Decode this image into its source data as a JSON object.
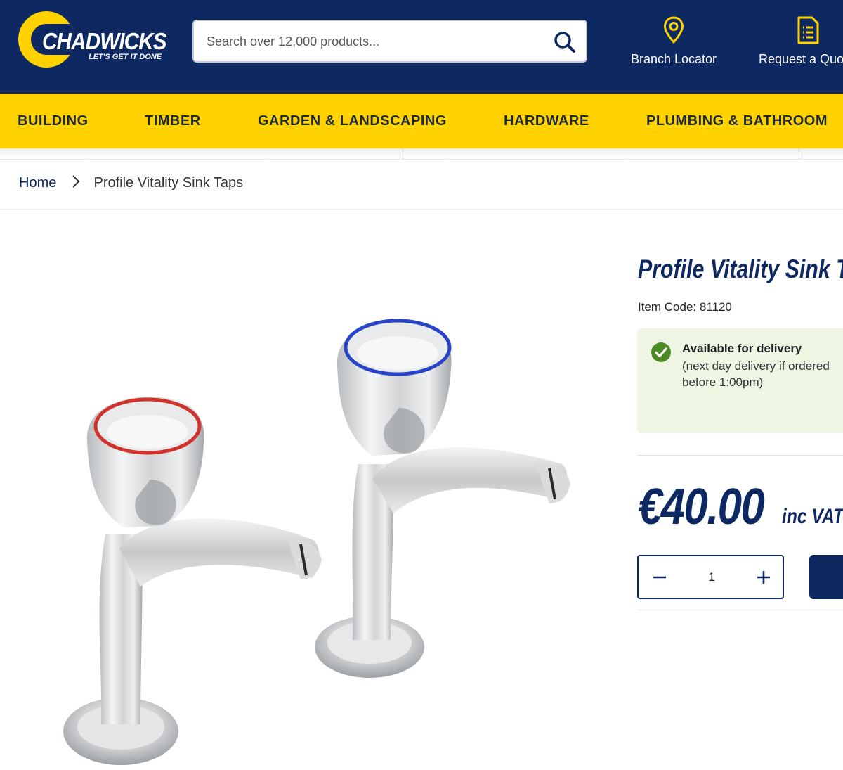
{
  "brand": {
    "name": "CHADWICKS",
    "tagline": "LET'S GET IT DONE"
  },
  "search": {
    "placeholder": "Search over 12,000 products..."
  },
  "header_links": [
    {
      "label": "Branch Locator",
      "icon": "location-pin-icon"
    },
    {
      "label": "Request a Quote",
      "icon": "quote-document-icon"
    }
  ],
  "nav": {
    "items": [
      "BUILDING",
      "TIMBER",
      "GARDEN & LANDSCAPING",
      "HARDWARE",
      "PLUMBING & BATHROOM"
    ]
  },
  "breadcrumb": {
    "home": "Home",
    "current": "Profile Vitality Sink Taps"
  },
  "product": {
    "title": "Profile Vitality Sink Taps",
    "item_code": "Item Code: 81120",
    "availability": {
      "title": "Available for delivery",
      "detail": "(next day delivery if ordered before 1:00pm)"
    },
    "price": "€40.00",
    "price_suffix": "inc VAT",
    "quantity": "1"
  },
  "colors": {
    "navy": "#0e2862",
    "yellow": "#ffd200",
    "stock_bg": "#eef5e3",
    "stock_check": "#4c8a25"
  }
}
